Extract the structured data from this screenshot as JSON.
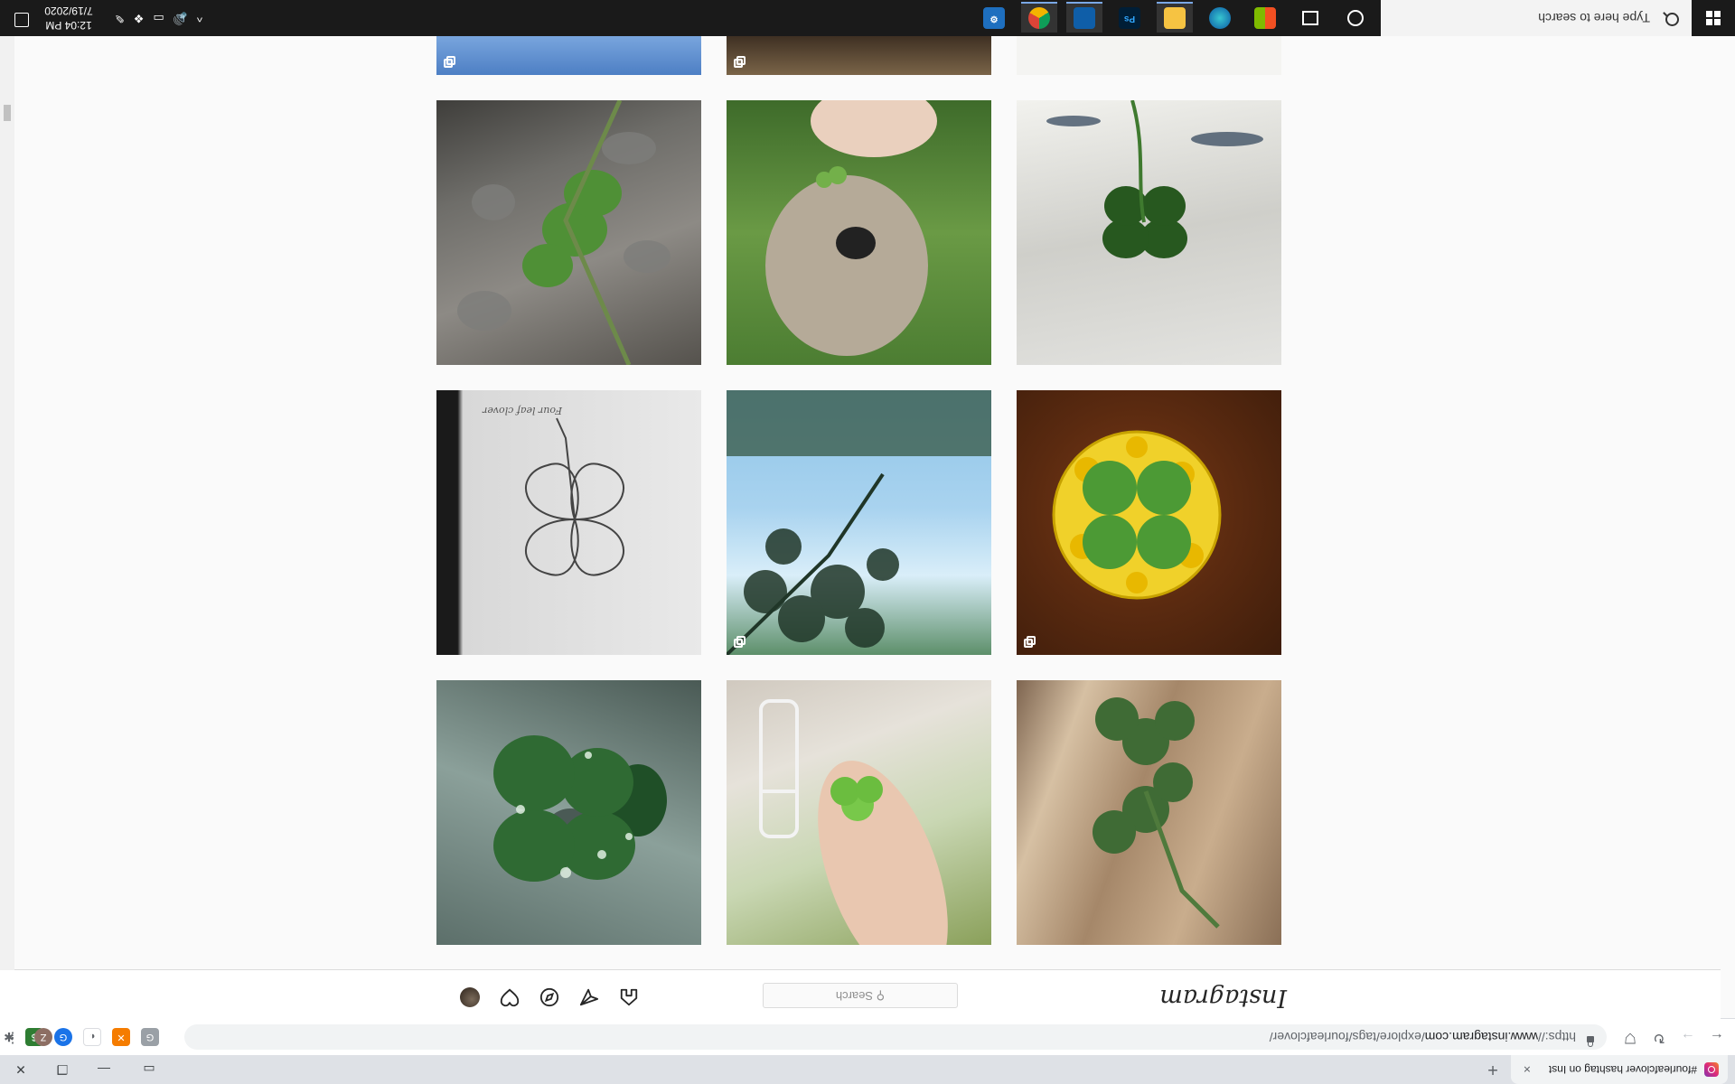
{
  "browser": {
    "tab_title": "#fourleafclover hashtag on Inst",
    "tab_close": "×",
    "new_tab": "+",
    "url_prefix": "https://",
    "url_host": "www.instagram.com",
    "url_path": "/explore/tags/fourleafclover/",
    "extensions": [
      "G",
      "✕",
      "◐",
      "G",
      "$",
      "✱",
      "Z"
    ]
  },
  "instagram": {
    "logo": "Instagram",
    "search_placeholder": "Search",
    "nav_icons": [
      "home-icon",
      "direct-icon",
      "explore-icon",
      "activity-icon",
      "profile-avatar"
    ]
  },
  "grid": {
    "tiles": [
      {
        "name": "tile-clover-stem-on-wood",
        "multiple": false
      },
      {
        "name": "tile-hand-holding-clover",
        "multiple": false
      },
      {
        "name": "tile-clover-with-water-drops",
        "multiple": false
      },
      {
        "name": "tile-clover-in-resin-dome",
        "multiple": true
      },
      {
        "name": "tile-tree-and-sky",
        "multiple": true
      },
      {
        "name": "tile-clover-pencil-drawing",
        "multiple": false,
        "caption": "Four leaf clover"
      },
      {
        "name": "tile-clover-on-cloth",
        "multiple": false
      },
      {
        "name": "tile-dog-and-clover",
        "multiple": false
      },
      {
        "name": "tile-clover-among-rocks",
        "multiple": false
      }
    ]
  },
  "taskbar": {
    "search_placeholder": "Type here to search",
    "time": "12:04 PM",
    "date": "7/19/2020",
    "apps": [
      "cortana-icon",
      "task-view-icon",
      "microsoft-store-icon",
      "edge-icon",
      "file-explorer-icon",
      "photoshop-icon",
      "onedrive-icon",
      "chrome-icon",
      "settings-icon"
    ],
    "ps_label": "Ps"
  }
}
